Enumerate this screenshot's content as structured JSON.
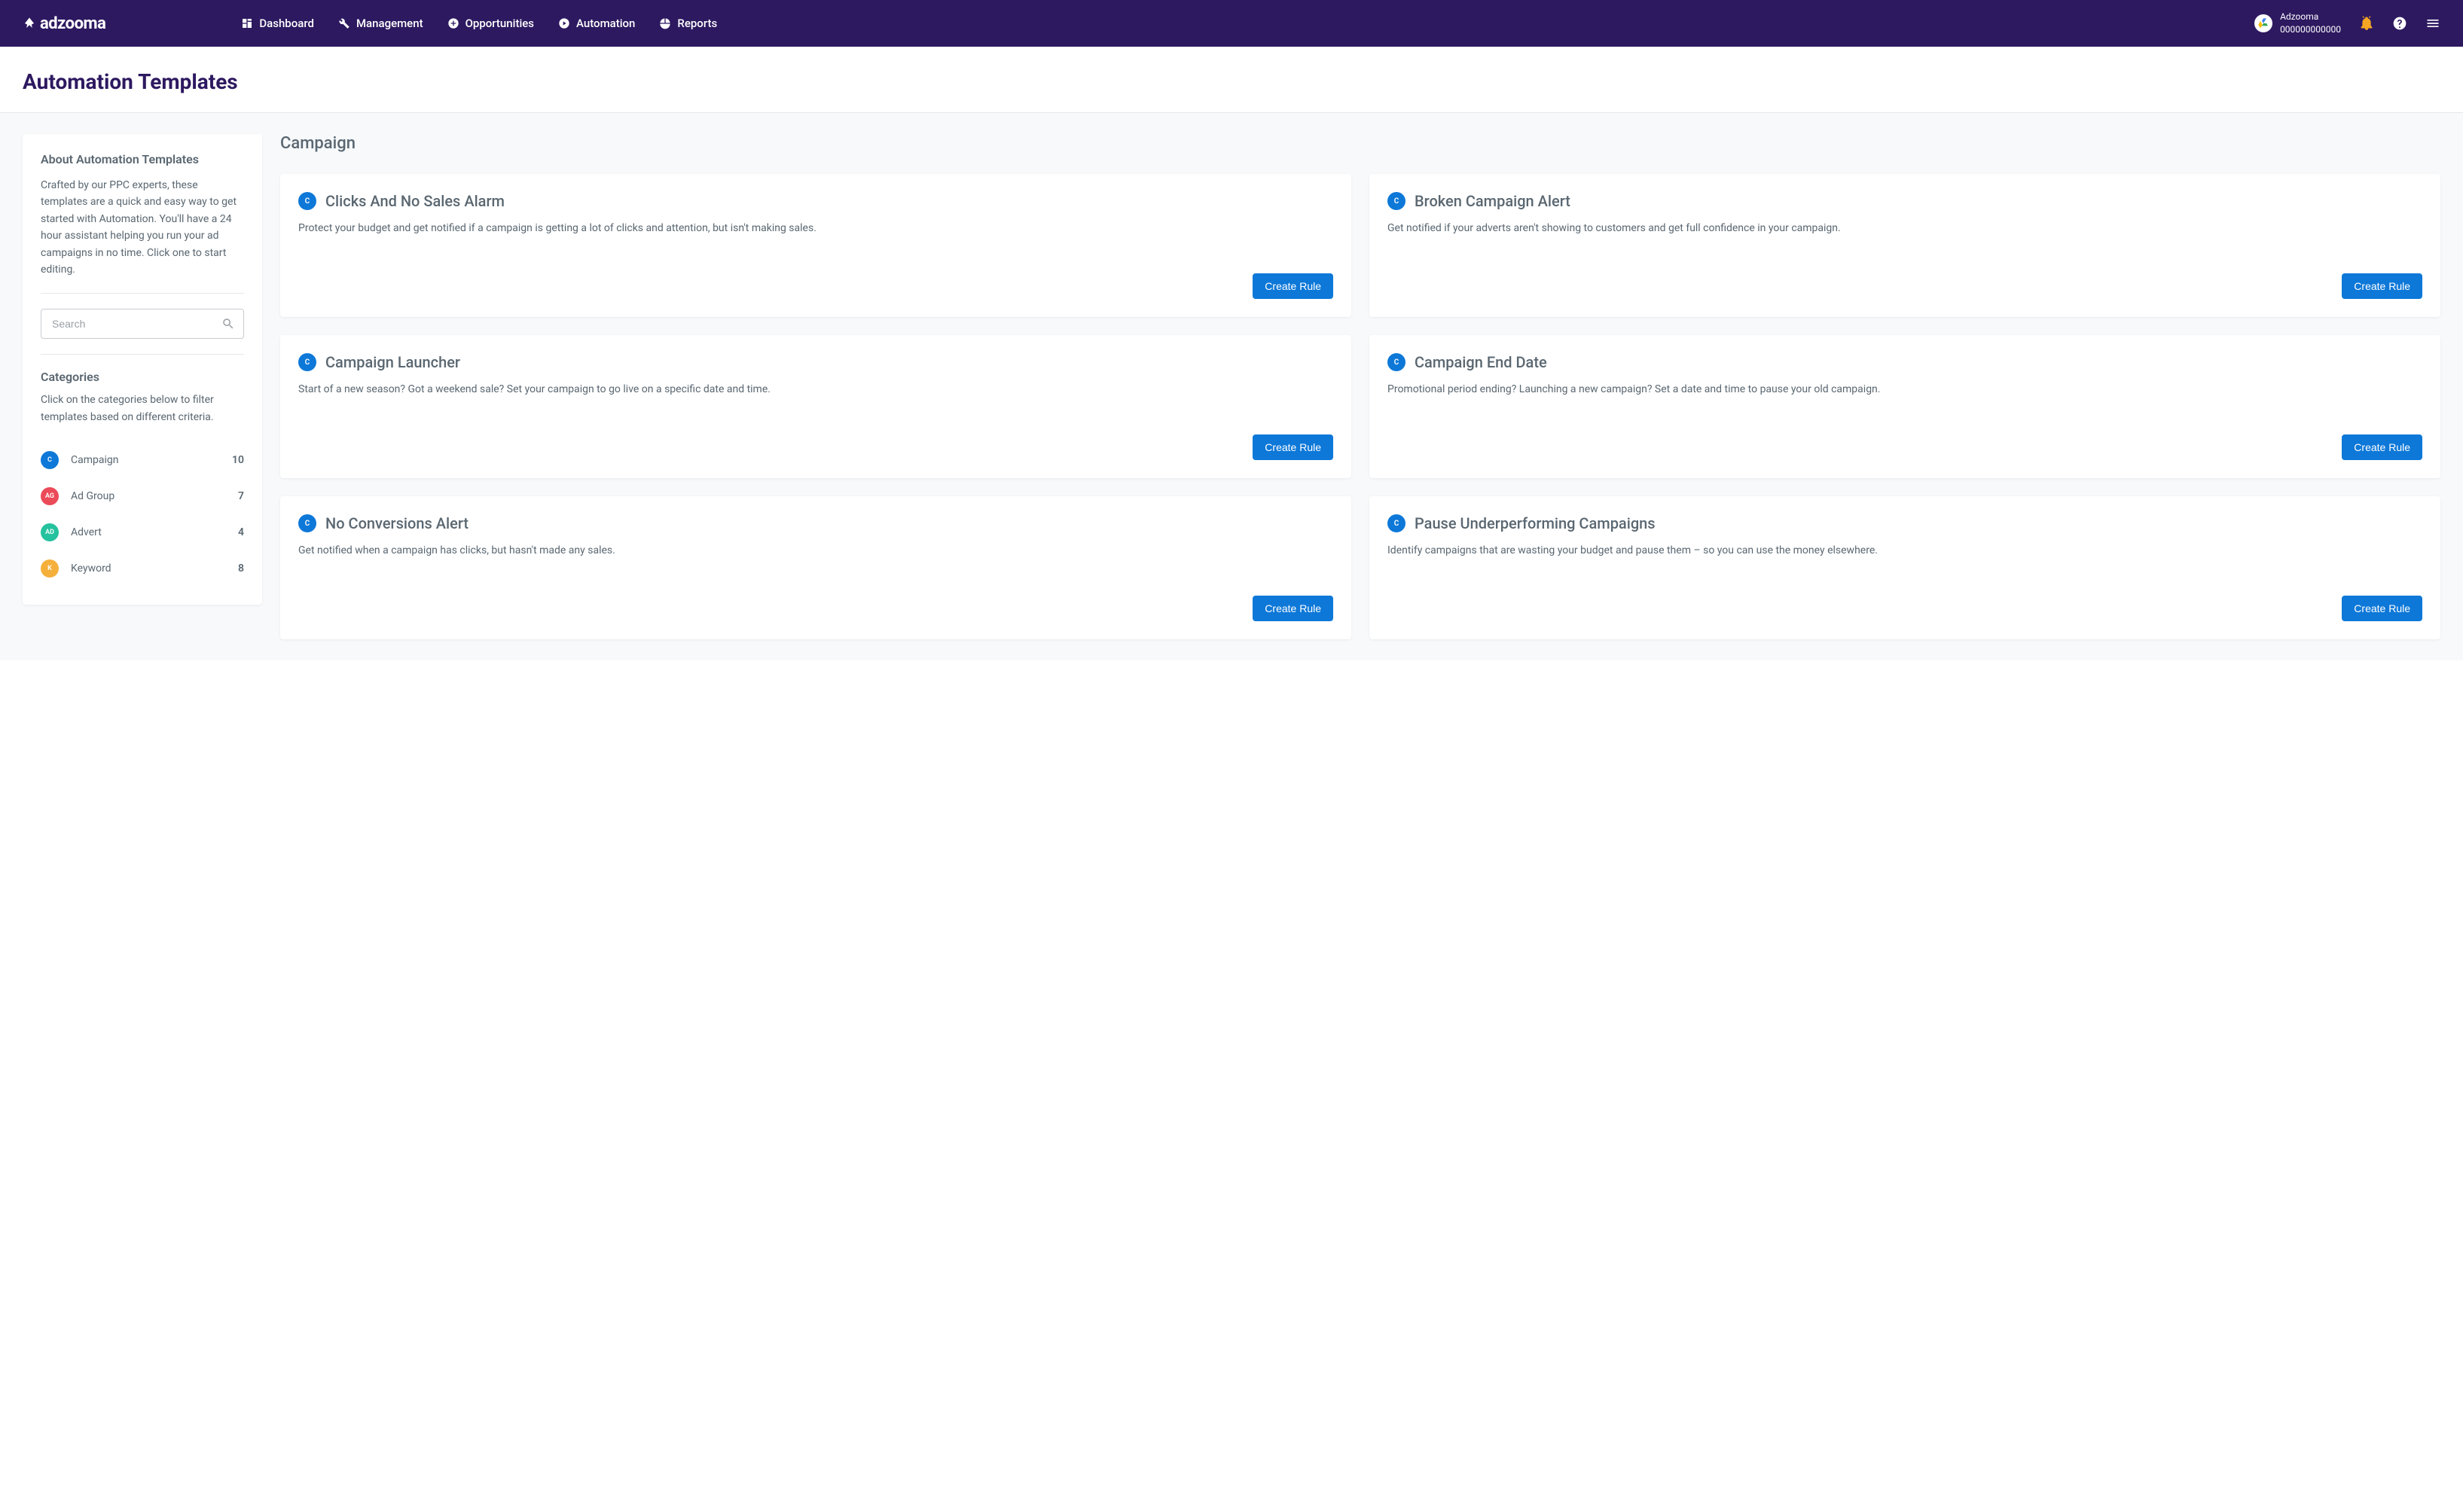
{
  "brand": "adzooma",
  "nav": {
    "dashboard": "Dashboard",
    "management": "Management",
    "opportunities": "Opportunities",
    "automation": "Automation",
    "reports": "Reports"
  },
  "account": {
    "name": "Adzooma",
    "id": "000000000000"
  },
  "page_title": "Automation Templates",
  "sidebar": {
    "about_title": "About Automation Templates",
    "about_desc": "Crafted by our PPC experts, these templates are a quick and easy way to get started with Automation. You'll have a 24 hour assistant helping you run your ad campaigns in no time. Click one to start editing.",
    "search_placeholder": "Search",
    "categories_title": "Categories",
    "categories_desc": "Click on the categories below to filter templates based on different criteria.",
    "categories": [
      {
        "badge": "C",
        "label": "Campaign",
        "count": "10",
        "color": "#0d78d8"
      },
      {
        "badge": "AG",
        "label": "Ad Group",
        "count": "7",
        "color": "#eb4a58"
      },
      {
        "badge": "AD",
        "label": "Advert",
        "count": "4",
        "color": "#25c29f"
      },
      {
        "badge": "K",
        "label": "Keyword",
        "count": "8",
        "color": "#f5b03c"
      }
    ]
  },
  "section_title": "Campaign",
  "create_label": "Create Rule",
  "cards": [
    {
      "badge": "C",
      "title": "Clicks And No Sales Alarm",
      "desc": "Protect your budget and get notified if a campaign is getting a lot of clicks and attention, but isn't making sales."
    },
    {
      "badge": "C",
      "title": "Broken Campaign Alert",
      "desc": "Get notified if your adverts aren't showing to customers and get full confidence in your campaign."
    },
    {
      "badge": "C",
      "title": "Campaign Launcher",
      "desc": "Start of a new season? Got a weekend sale? Set your campaign to go live on a specific date and time."
    },
    {
      "badge": "C",
      "title": "Campaign End Date",
      "desc": "Promotional period ending? Launching a new campaign? Set a date and time to pause your old campaign."
    },
    {
      "badge": "C",
      "title": "No Conversions Alert",
      "desc": "Get notified when a campaign has clicks, but hasn't made any sales."
    },
    {
      "badge": "C",
      "title": "Pause Underperforming Campaigns",
      "desc": "Identify campaigns that are wasting your budget and pause them – so you can use the money elsewhere."
    }
  ]
}
